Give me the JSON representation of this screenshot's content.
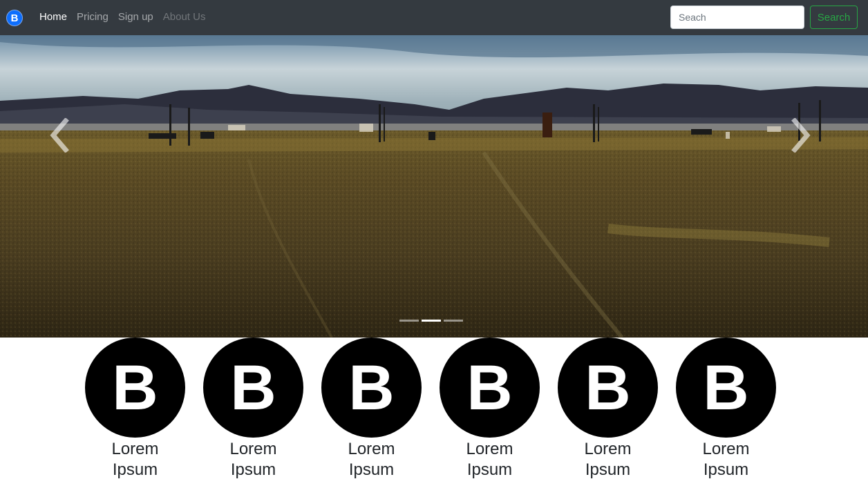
{
  "navbar": {
    "brand_letter": "B",
    "links": [
      {
        "label": "Home",
        "state": "active"
      },
      {
        "label": "Pricing",
        "state": "normal"
      },
      {
        "label": "Sign up",
        "state": "normal"
      },
      {
        "label": "About Us",
        "state": "disabled"
      }
    ],
    "search_placeholder": "Seach",
    "search_button": "Search"
  },
  "carousel": {
    "slide_count": 3,
    "active_slide": 2,
    "prev_icon": "chevron-left-icon",
    "next_icon": "chevron-right-icon"
  },
  "features": [
    {
      "logo": "B",
      "title": "Lorem Ipsum"
    },
    {
      "logo": "B",
      "title": "Lorem Ipsum"
    },
    {
      "logo": "B",
      "title": "Lorem Ipsum"
    },
    {
      "logo": "B",
      "title": "Lorem Ipsum"
    },
    {
      "logo": "B",
      "title": "Lorem Ipsum"
    },
    {
      "logo": "B",
      "title": "Lorem Ipsum"
    }
  ],
  "colors": {
    "navbar_bg": "#343a40",
    "brand_blue": "#0d6efd",
    "success_green": "#28a745"
  }
}
